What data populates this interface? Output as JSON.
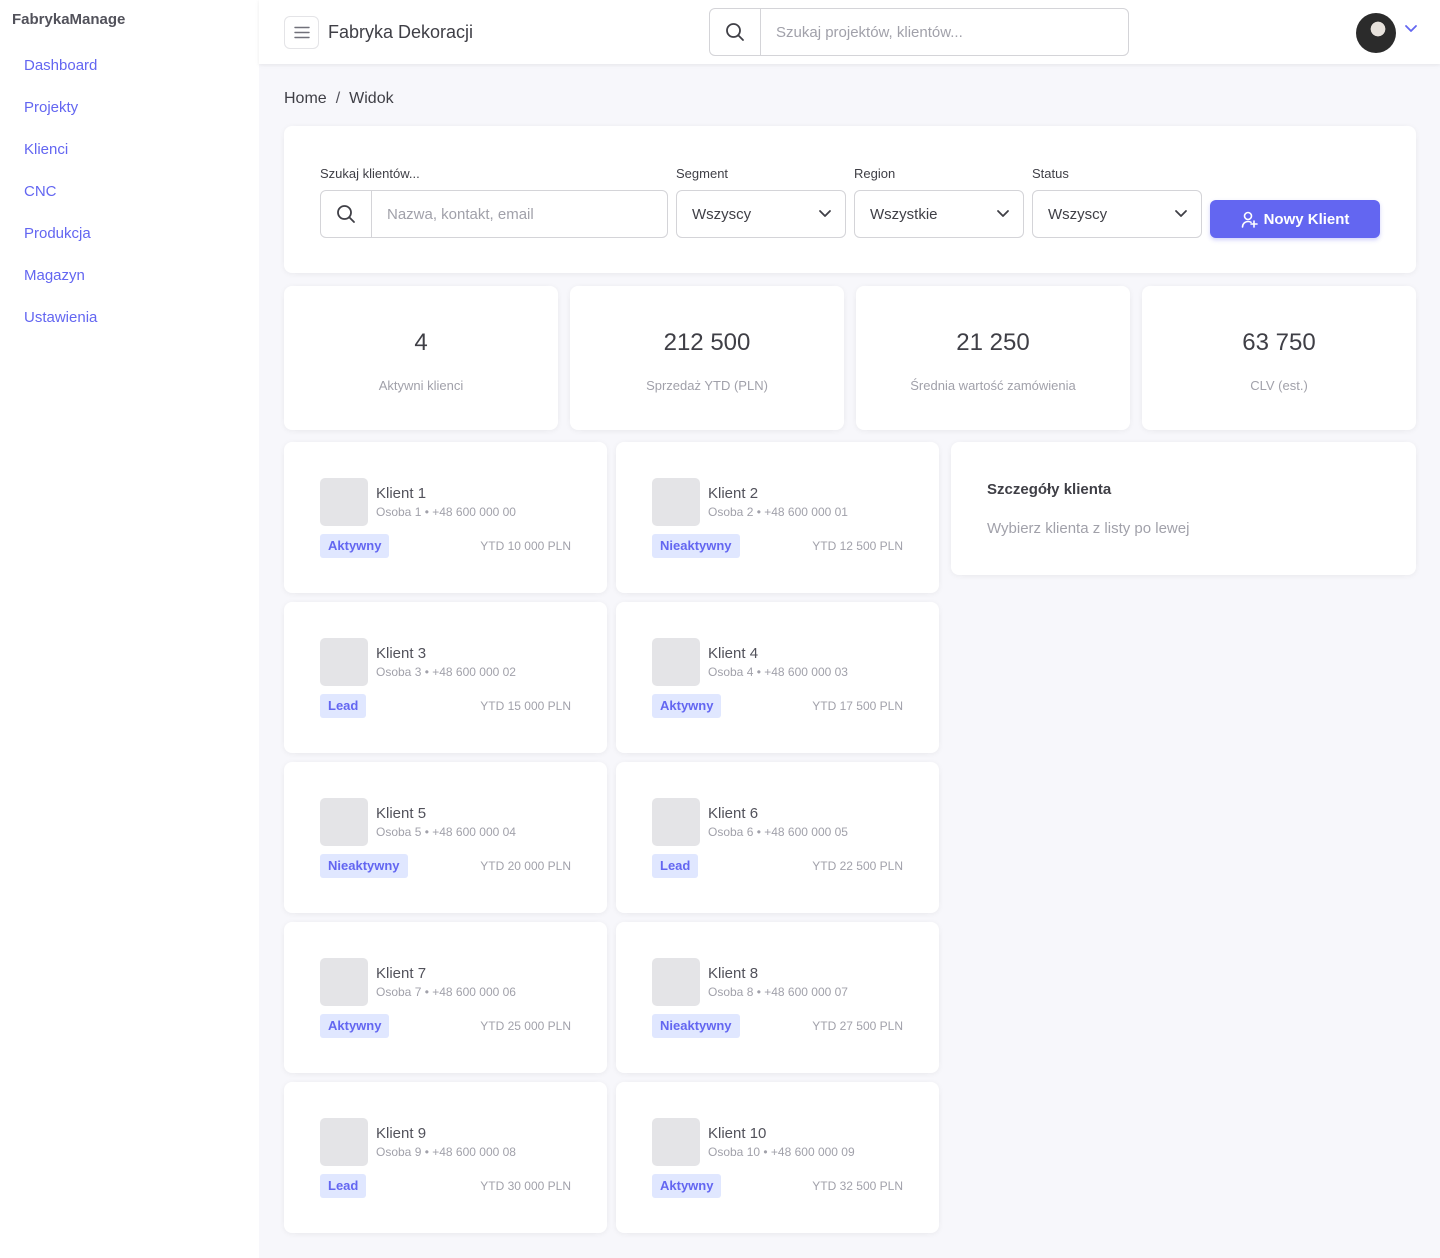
{
  "sidebar": {
    "brand": "FabrykaManage",
    "items": [
      {
        "label": "Dashboard"
      },
      {
        "label": "Projekty"
      },
      {
        "label": "Klienci"
      },
      {
        "label": "CNC"
      },
      {
        "label": "Produkcja"
      },
      {
        "label": "Magazyn"
      },
      {
        "label": "Ustawienia"
      }
    ]
  },
  "header": {
    "title": "Fabryka Dekoracji",
    "search_placeholder": "Szukaj projektów, klientów..."
  },
  "breadcrumb": {
    "home": "Home",
    "separator": "/",
    "current": "Widok"
  },
  "filters": {
    "search_label": "Szukaj klientów...",
    "search_placeholder": "Nazwa, kontakt, email",
    "segment_label": "Segment",
    "segment_value": "Wszyscy",
    "region_label": "Region",
    "region_value": "Wszystkie",
    "status_label": "Status",
    "status_value": "Wszyscy",
    "new_button": "Nowy Klient"
  },
  "stats": [
    {
      "value": "4",
      "label": "Aktywni klienci"
    },
    {
      "value": "212 500",
      "label": "Sprzedaż YTD (PLN)"
    },
    {
      "value": "21 250",
      "label": "Średnia wartość zamówienia"
    },
    {
      "value": "63 750",
      "label": "CLV (est.)"
    }
  ],
  "clients": [
    {
      "name": "Klient 1",
      "contact": "Osoba 1 • +48 600 000 00",
      "status": "Aktywny",
      "ytd": "YTD 10 000 PLN"
    },
    {
      "name": "Klient 2",
      "contact": "Osoba 2 • +48 600 000 01",
      "status": "Nieaktywny",
      "ytd": "YTD 12 500 PLN"
    },
    {
      "name": "Klient 3",
      "contact": "Osoba 3 • +48 600 000 02",
      "status": "Lead",
      "ytd": "YTD 15 000 PLN"
    },
    {
      "name": "Klient 4",
      "contact": "Osoba 4 • +48 600 000 03",
      "status": "Aktywny",
      "ytd": "YTD 17 500 PLN"
    },
    {
      "name": "Klient 5",
      "contact": "Osoba 5 • +48 600 000 04",
      "status": "Nieaktywny",
      "ytd": "YTD 20 000 PLN"
    },
    {
      "name": "Klient 6",
      "contact": "Osoba 6 • +48 600 000 05",
      "status": "Lead",
      "ytd": "YTD 22 500 PLN"
    },
    {
      "name": "Klient 7",
      "contact": "Osoba 7 • +48 600 000 06",
      "status": "Aktywny",
      "ytd": "YTD 25 000 PLN"
    },
    {
      "name": "Klient 8",
      "contact": "Osoba 8 • +48 600 000 07",
      "status": "Nieaktywny",
      "ytd": "YTD 27 500 PLN"
    },
    {
      "name": "Klient 9",
      "contact": "Osoba 9 • +48 600 000 08",
      "status": "Lead",
      "ytd": "YTD 30 000 PLN"
    },
    {
      "name": "Klient 10",
      "contact": "Osoba 10 • +48 600 000 09",
      "status": "Aktywny",
      "ytd": "YTD 32 500 PLN"
    }
  ],
  "details": {
    "title": "Szczegóły klienta",
    "empty": "Wybierz klienta z listy po lewej"
  },
  "colors": {
    "accent": "#6366f1",
    "badge_bg": "#e0e7ff",
    "muted": "#a1a1aa"
  },
  "icons": [
    "menu-icon",
    "search-icon",
    "chevron-down-icon",
    "user-plus-icon",
    "avatar"
  ]
}
